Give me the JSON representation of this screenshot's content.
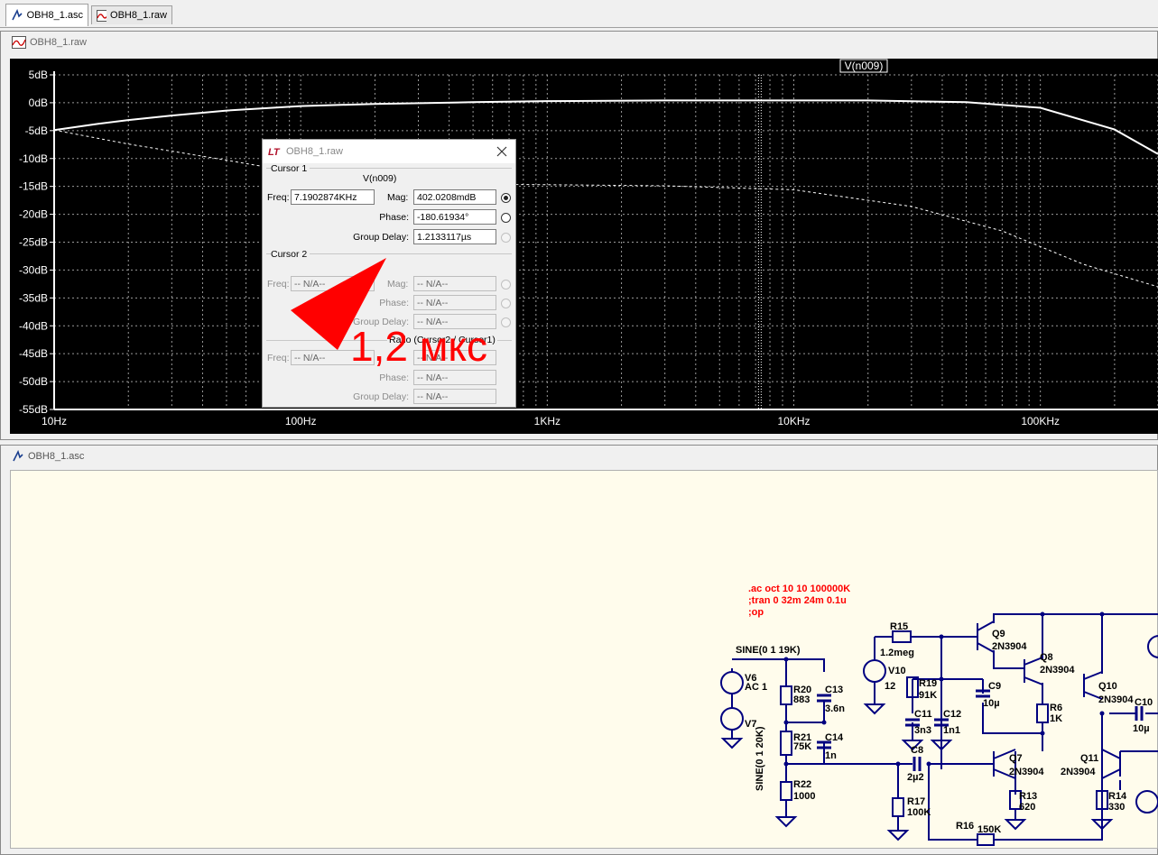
{
  "tabs": [
    {
      "label": "OBH8_1.asc",
      "icon": "schematic-icon",
      "active": true
    },
    {
      "label": "OBH8_1.raw",
      "icon": "waveform-icon",
      "active": false
    }
  ],
  "plot_pane": {
    "title": "OBH8_1.raw"
  },
  "schematic_pane": {
    "title": "OBH8_1.asc"
  },
  "chart_data": {
    "type": "line",
    "title": "V(n009)",
    "xscale": "log",
    "x_ticks": [
      "10Hz",
      "100Hz",
      "1KHz",
      "10KHz",
      "100KHz"
    ],
    "y_ticks": [
      "5dB",
      "0dB",
      "-5dB",
      "-10dB",
      "-15dB",
      "-20dB",
      "-25dB",
      "-30dB",
      "-35dB",
      "-40dB",
      "-45dB",
      "-50dB",
      "-55dB"
    ],
    "xlim": [
      10,
      300000
    ],
    "ylim": [
      -55,
      5
    ],
    "grid": true,
    "series": [
      {
        "name": "V(n009)",
        "style": "solid",
        "color": "#ffffff",
        "x": [
          10,
          15,
          20,
          30,
          50,
          100,
          200,
          500,
          1000,
          3000,
          7190,
          20000,
          50000,
          100000,
          200000,
          300000
        ],
        "y": [
          -4.9,
          -3.8,
          -3.1,
          -2.3,
          -1.4,
          -0.6,
          -0.2,
          0.1,
          0.3,
          0.4,
          0.4,
          0.4,
          0.1,
          -0.9,
          -4.8,
          -9.2
        ]
      },
      {
        "name": "phase",
        "style": "dashed",
        "color": "#ffffff",
        "x": [
          10,
          20,
          50,
          100,
          200,
          500,
          1000,
          3000,
          10000,
          30000,
          70000,
          150000,
          300000
        ],
        "y": [
          -4.9,
          -7.4,
          -10.3,
          -12.6,
          -14.0,
          -14.6,
          -14.7,
          -14.9,
          -15.6,
          -18.6,
          -23.0,
          -29.0,
          -33.0
        ]
      }
    ],
    "cursor_x": 7190
  },
  "dialog": {
    "title": "OBH8_1.raw",
    "cursor1": {
      "group": "Cursor 1",
      "trace": "V(n009)",
      "freq_label": "Freq:",
      "freq": "7.1902874KHz",
      "mag_label": "Mag:",
      "mag": "402.0208mdB",
      "phase_label": "Phase:",
      "phase": "-180.61934°",
      "gd_label": "Group Delay:",
      "gd": "1.2133117µs"
    },
    "cursor2": {
      "group": "Cursor 2",
      "freq_label": "Freq:",
      "freq": "-- N/A--",
      "mag_label": "Mag:",
      "mag": "-- N/A--",
      "phase_label": "Phase:",
      "phase": "-- N/A--",
      "gd_label": "Group Delay:",
      "gd": "-- N/A--"
    },
    "ratio": {
      "group": "Ratio (Cursor2 / Cursor1)",
      "freq_label": "Freq:",
      "freq": "-- N/A--",
      "mag": "-- N/A--",
      "phase_label": "Phase:",
      "phase": "-- N/A--",
      "gd_label": "Group Delay:",
      "gd": "-- N/A--"
    }
  },
  "annotation": {
    "text": "1,2 мкс",
    "color": "#ff0000"
  },
  "schematic": {
    "directive1": ".ac oct 10 10 100000K",
    "directive2": ";tran 0 32m 24m 0.1u",
    "directive3": ";op",
    "source_label": "SINE(0 1 19K)",
    "source_label2": "SINE(0 1 20K)",
    "components": [
      {
        "ref": "V6",
        "value": "AC 1"
      },
      {
        "ref": "V7",
        "value": ""
      },
      {
        "ref": "R20",
        "value": "883"
      },
      {
        "ref": "C13",
        "value": "3.6n"
      },
      {
        "ref": "R21",
        "value": "75K"
      },
      {
        "ref": "C14",
        "value": "1n"
      },
      {
        "ref": "R22",
        "value": "1000"
      },
      {
        "ref": "R15",
        "value": "1.2meg"
      },
      {
        "ref": "V10",
        "value": "12"
      },
      {
        "ref": "R19",
        "value": "91K"
      },
      {
        "ref": "C9",
        "value": "10µ"
      },
      {
        "ref": "C11",
        "value": "3n3"
      },
      {
        "ref": "C12",
        "value": "1n1"
      },
      {
        "ref": "C8",
        "value": "2µ2"
      },
      {
        "ref": "R17",
        "value": "100K"
      },
      {
        "ref": "R16",
        "value": "150K"
      },
      {
        "ref": "Q9",
        "value": "2N3904"
      },
      {
        "ref": "Q8",
        "value": "2N3904"
      },
      {
        "ref": "R6",
        "value": "1K"
      },
      {
        "ref": "Q10",
        "value": "2N3904"
      },
      {
        "ref": "C10",
        "value": "10µ"
      },
      {
        "ref": "Q7",
        "value": "2N3904"
      },
      {
        "ref": "R13",
        "value": "620"
      },
      {
        "ref": "Q11",
        "value": "2N3904"
      },
      {
        "ref": "R14",
        "value": "330"
      }
    ]
  }
}
